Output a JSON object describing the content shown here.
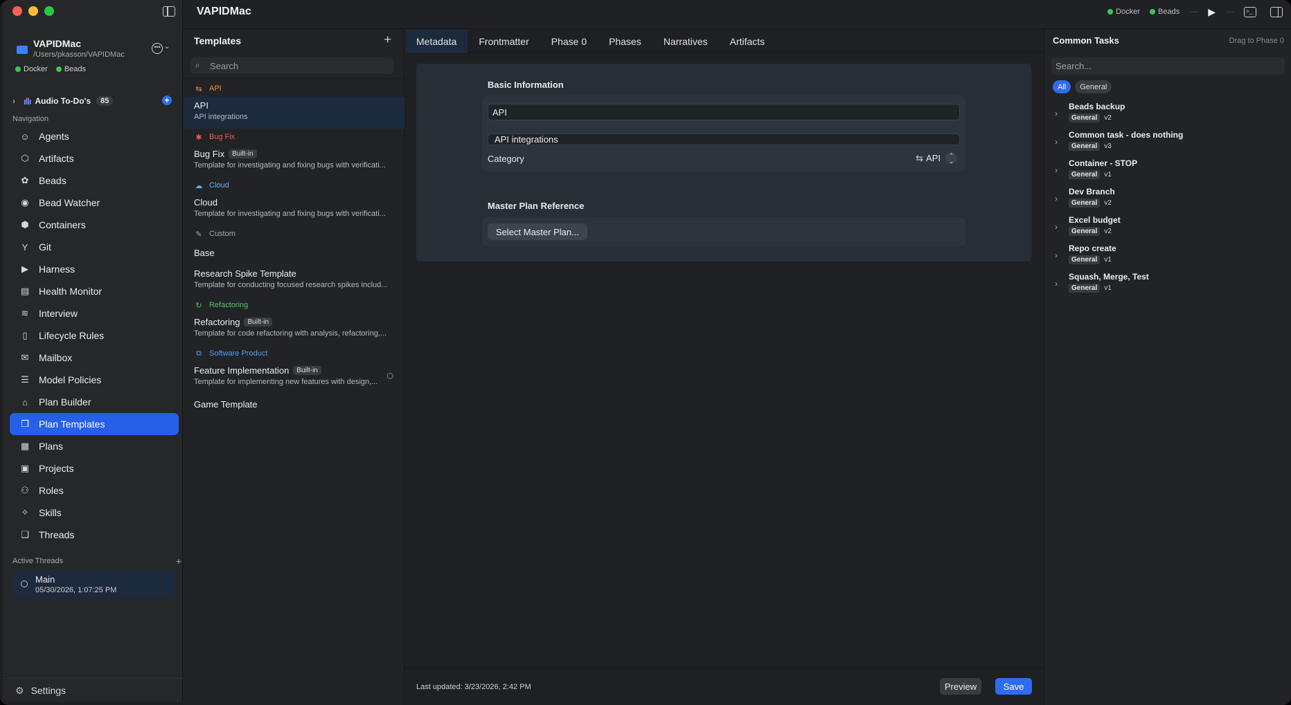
{
  "app": {
    "title": "VAPIDMac",
    "status": [
      "Docker",
      "Beads"
    ]
  },
  "project": {
    "name": "VAPIDMac",
    "path": "/Users/pkasson/VAPIDMac",
    "status": [
      "Docker",
      "Beads"
    ]
  },
  "audio": {
    "label": "Audio To-Do's",
    "count": "85"
  },
  "navigation": {
    "header": "Navigation",
    "items": [
      {
        "label": "Agents",
        "icon": "agents-icon",
        "glyph": "☺"
      },
      {
        "label": "Artifacts",
        "icon": "cube-icon",
        "glyph": "⬡"
      },
      {
        "label": "Beads",
        "icon": "beads-icon",
        "glyph": "✿"
      },
      {
        "label": "Bead Watcher",
        "icon": "eye-icon",
        "glyph": "◉"
      },
      {
        "label": "Containers",
        "icon": "box-icon",
        "glyph": "⬢"
      },
      {
        "label": "Git",
        "icon": "branch-icon",
        "glyph": "Y"
      },
      {
        "label": "Harness",
        "icon": "play-square-icon",
        "glyph": "▶"
      },
      {
        "label": "Health Monitor",
        "icon": "clipboard-icon",
        "glyph": "▤"
      },
      {
        "label": "Interview",
        "icon": "waveform-icon",
        "glyph": "≋"
      },
      {
        "label": "Lifecycle Rules",
        "icon": "document-icon",
        "glyph": "▯"
      },
      {
        "label": "Mailbox",
        "icon": "tray-icon",
        "glyph": "✉"
      },
      {
        "label": "Model Policies",
        "icon": "sliders-icon",
        "glyph": "☰"
      },
      {
        "label": "Plan Builder",
        "icon": "builder-icon",
        "glyph": "⌂"
      },
      {
        "label": "Plan Templates",
        "icon": "templates-icon",
        "glyph": "❐"
      },
      {
        "label": "Plans",
        "icon": "list-icon",
        "glyph": "▦"
      },
      {
        "label": "Projects",
        "icon": "briefcase-icon",
        "glyph": "▣"
      },
      {
        "label": "Roles",
        "icon": "person-icon",
        "glyph": "⚇"
      },
      {
        "label": "Skills",
        "icon": "sparkle-icon",
        "glyph": "✧"
      },
      {
        "label": "Threads",
        "icon": "threads-icon",
        "glyph": "❏"
      }
    ],
    "active_index": 13
  },
  "threads": {
    "header": "Active Threads",
    "items": [
      {
        "name": "Main",
        "date": "05/30/2026, 1:07:25 PM"
      }
    ]
  },
  "settings_label": "Settings",
  "templates": {
    "title": "Templates",
    "search_placeholder": "Search",
    "groups": [
      {
        "category": "API",
        "color": "#f0953b",
        "glyph": "⇆",
        "icon": "arrows-icon",
        "items": [
          {
            "name": "API",
            "desc": "API integrations",
            "builtin": false,
            "selected": true
          }
        ]
      },
      {
        "category": "Bug Fix",
        "color": "#ef5a4f",
        "glyph": "✱",
        "icon": "bug-icon",
        "items": [
          {
            "name": "Bug Fix",
            "desc": "Template for investigating and fixing bugs with verificati...",
            "builtin": true
          }
        ]
      },
      {
        "category": "Cloud",
        "color": "#5ab4f0",
        "glyph": "☁",
        "icon": "cloud-icon",
        "items": [
          {
            "name": "Cloud",
            "desc": "Template for investigating and fixing bugs with verificati...",
            "builtin": false
          }
        ]
      },
      {
        "category": "Custom",
        "color": "#a8a8a8",
        "glyph": "✎",
        "icon": "pencil-icon",
        "items": [
          {
            "name": "Base",
            "desc": "",
            "builtin": false
          },
          {
            "name": "Research Spike Template",
            "desc": "Template for conducting focused research spikes includ...",
            "builtin": false
          }
        ]
      },
      {
        "category": "Refactoring",
        "color": "#4cc86a",
        "glyph": "↻",
        "icon": "refresh-icon",
        "items": [
          {
            "name": "Refactoring",
            "desc": "Template for code refactoring with analysis, refactoring,...",
            "builtin": true
          }
        ]
      },
      {
        "category": "Software Product",
        "color": "#4aa0f0",
        "glyph": "⧉",
        "icon": "external-icon",
        "items": [
          {
            "name": "Feature Implementation",
            "desc": "Template for implementing new features with design,...",
            "builtin": true,
            "cube": true
          },
          {
            "name": "Game Template",
            "desc": "",
            "builtin": false
          }
        ]
      }
    ],
    "builtin_label": "Built-in"
  },
  "editor": {
    "tabs": [
      "Metadata",
      "Frontmatter",
      "Phase 0",
      "Phases",
      "Narratives",
      "Artifacts"
    ],
    "active_tab": 0,
    "basic_info_title": "Basic Information",
    "name_value": "API",
    "desc_value": "API integrations",
    "category_label": "Category",
    "category_value": "API",
    "master_plan_title": "Master Plan Reference",
    "select_master_plan": "Select Master Plan...",
    "last_updated": "Last updated: 3/23/2026, 2:42 PM",
    "preview_label": "Preview",
    "save_label": "Save"
  },
  "common_tasks": {
    "title": "Common Tasks",
    "hint": "Drag to Phase 0",
    "search_placeholder": "Search...",
    "filters": [
      "All",
      "General"
    ],
    "active_filter": 0,
    "items": [
      {
        "name": "Beads backup",
        "group": "General",
        "version": "v2"
      },
      {
        "name": "Common task - does nothing",
        "group": "General",
        "version": "v3"
      },
      {
        "name": "Container - STOP",
        "group": "General",
        "version": "v1"
      },
      {
        "name": "Dev Branch",
        "group": "General",
        "version": "v2"
      },
      {
        "name": "Excel budget",
        "group": "General",
        "version": "v2"
      },
      {
        "name": "Repo create",
        "group": "General",
        "version": "v1"
      },
      {
        "name": "Squash, Merge, Test",
        "group": "General",
        "version": "v1"
      }
    ]
  },
  "colors": {
    "accent": "#2f6cf0",
    "status_green": "#34c759",
    "traffic_red": "#ff5f57",
    "traffic_yellow": "#febc2e",
    "traffic_green": "#28c840"
  }
}
